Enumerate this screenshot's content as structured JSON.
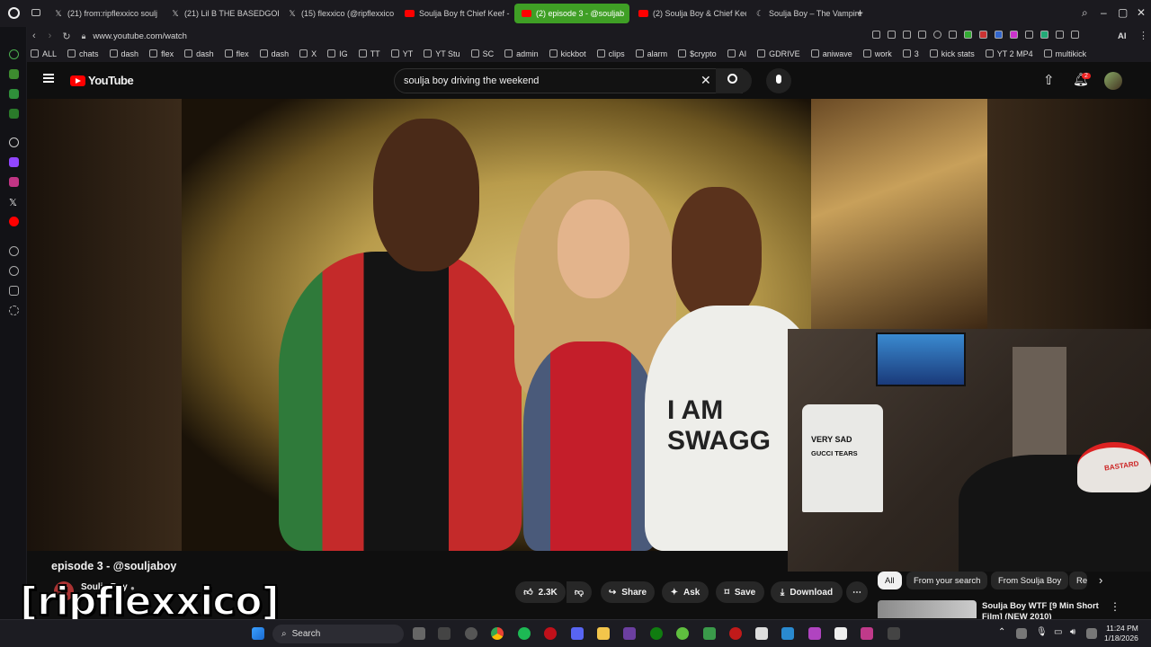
{
  "browser": {
    "tabs": [
      {
        "label": "(21) from:ripflexxico soulj",
        "icon": "x-icon"
      },
      {
        "label": "(21) Lil B THE BASEDGOD",
        "icon": "x-icon"
      },
      {
        "label": "(15) flexxico (@ripflexxico",
        "icon": "x-icon"
      },
      {
        "label": "Soulja Boy ft Chief Keef -",
        "icon": "youtube-icon"
      },
      {
        "label": "(2) episode 3 - @souljab",
        "icon": "youtube-icon",
        "active": true
      },
      {
        "label": "(2) Soulja Boy & Chief Kee",
        "icon": "youtube-icon"
      },
      {
        "label": "Soulja Boy – The Vampire",
        "icon": "moon-icon"
      }
    ],
    "new_tab": "+",
    "url": "www.youtube.com/watch",
    "ai_label": "AI",
    "bookmarks": [
      "ALL",
      "chats",
      "dash",
      "flex",
      "dash",
      "flex",
      "dash",
      "X",
      "IG",
      "TT",
      "YT",
      "YT Stu",
      "SC",
      "admin",
      "kickbot",
      "clips",
      "alarm",
      "$crypto",
      "AI",
      "GDRIVE",
      "aniwave",
      "work",
      "3",
      "kick stats",
      "YT 2 MP4",
      "multikick"
    ]
  },
  "youtube": {
    "logo_text": "YouTube",
    "search_value": "soulja boy driving the weekend",
    "notification_count": "2",
    "video_title": "episode 3 - @souljaboy",
    "channel_name": "Soulja Boy",
    "like_count": "2.3K",
    "actions": {
      "share": "Share",
      "ask": "Ask",
      "save": "Save",
      "download": "Download"
    },
    "chips": [
      "All",
      "From your search",
      "From Soulja Boy",
      "Re"
    ],
    "rec_title_line1": "Soulja Boy  WTF [9 Min Short",
    "rec_title_line2": "Film] (NEW 2010)"
  },
  "video_shirt_text": "I AM SWAGG",
  "webcam": {
    "shirt_text_1": "VERY SAD",
    "shirt_text_2": "GUCCI TEARS",
    "hat_text": "BASTARD"
  },
  "overlay_text": "[ripflexxico]",
  "taskbar": {
    "search_label": "Search",
    "time": "11:24 PM",
    "date": "1/18/2026"
  }
}
